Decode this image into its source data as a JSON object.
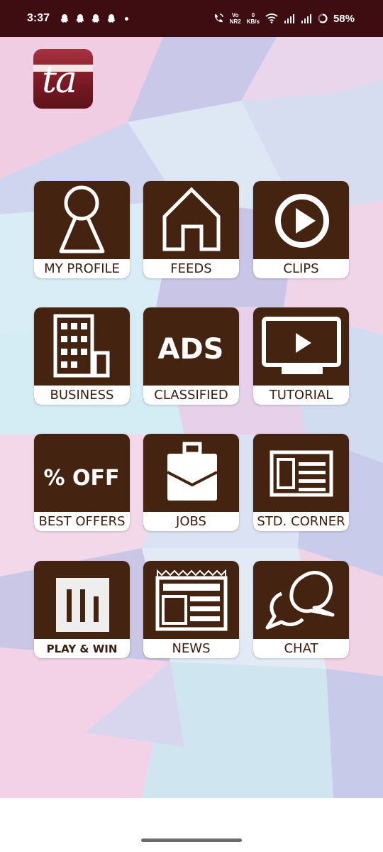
{
  "status_bar": {
    "time": "3:37",
    "network_label_top": "Vo",
    "network_label_bottom": "NR2",
    "speed_top": "0",
    "speed_bottom": "KB/s",
    "battery": "58%"
  },
  "logo": {
    "text": "ta"
  },
  "tiles": [
    {
      "label": "MY PROFILE",
      "icon": "person-icon"
    },
    {
      "label": "FEEDS",
      "icon": "home-icon"
    },
    {
      "label": "CLIPS",
      "icon": "play-circle-icon"
    },
    {
      "label": "BUSINESS",
      "icon": "building-icon"
    },
    {
      "label": "CLASSIFIED",
      "icon": "ads-icon",
      "icon_text": "ADS"
    },
    {
      "label": "TUTORIAL",
      "icon": "monitor-play-icon"
    },
    {
      "label": "BEST OFFERS",
      "icon": "percent-off-icon",
      "icon_text": "% OFF"
    },
    {
      "label": "JOBS",
      "icon": "briefcase-icon"
    },
    {
      "label": "STD. CORNER",
      "icon": "id-card-icon"
    },
    {
      "label": "PLAY & WIN",
      "icon": "bar-chart-icon"
    },
    {
      "label": "NEWS",
      "icon": "newspaper-icon"
    },
    {
      "label": "CHAT",
      "icon": "chat-bubbles-icon"
    }
  ],
  "colors": {
    "status_bar": "#3d0d12",
    "tile": "#442311",
    "label_text": "#3a1c0e"
  }
}
